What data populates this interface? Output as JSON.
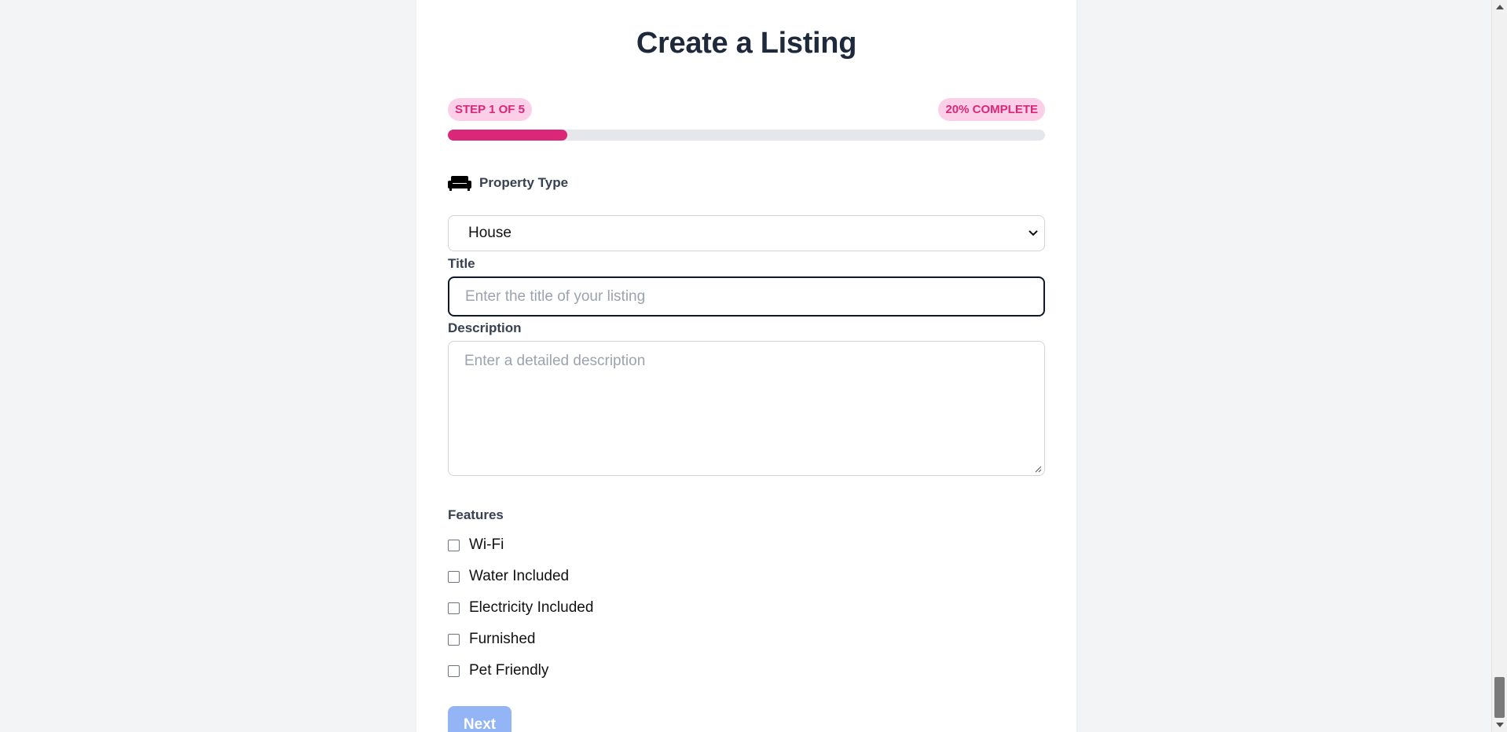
{
  "form": {
    "title": "Create a Listing",
    "step_text": "STEP 1 OF 5",
    "percent_text": "20% COMPLETE",
    "progress_fraction": 0.2,
    "property_type_label": "Property Type",
    "property_type_icon": "couch-icon",
    "property_type_value": "House",
    "title_label": "Title",
    "title_placeholder": "Enter the title of your listing",
    "description_label": "Description",
    "description_placeholder": "Enter a detailed description",
    "features_label": "Features",
    "features": [
      {
        "label": "Wi-Fi",
        "checked": false
      },
      {
        "label": "Water Included",
        "checked": false
      },
      {
        "label": "Electricity Included",
        "checked": false
      },
      {
        "label": "Furnished",
        "checked": false
      },
      {
        "label": "Pet Friendly",
        "checked": false
      }
    ],
    "next_label": "Next"
  },
  "colors": {
    "accent": "#db2777",
    "accent_light": "#fbcfe8",
    "button_disabled": "#93b4f5",
    "text_dark": "#1e293b"
  }
}
